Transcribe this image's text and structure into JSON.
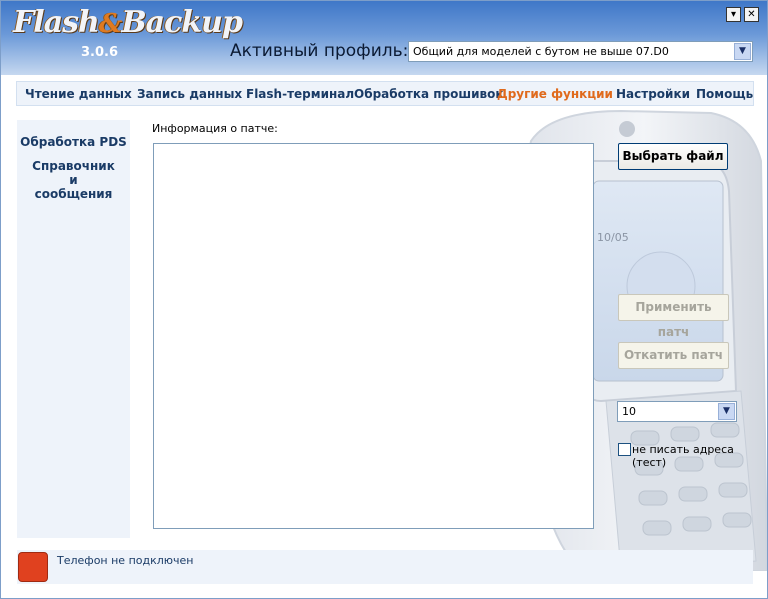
{
  "app": {
    "logo_main": "Flash",
    "logo_amp": "&",
    "logo_end": "Backup",
    "version": "3.0.6"
  },
  "window_controls": {
    "minimize_glyph": "▾",
    "close_glyph": "✕"
  },
  "profile": {
    "label": "Активный профиль:",
    "selected": "Общий для моделей с бутом не выше 07.D0"
  },
  "nav": {
    "items": [
      {
        "label": "Чтение данных",
        "active": false
      },
      {
        "label": "Запись данных",
        "active": false
      },
      {
        "label": "Flash-терминал",
        "active": false
      },
      {
        "label": "Обработка прошивок",
        "active": false
      },
      {
        "label": "Другие функции",
        "active": true
      },
      {
        "label": "Настройки",
        "active": false
      },
      {
        "label": "Помощь",
        "active": false
      }
    ]
  },
  "sidebar": {
    "items": [
      {
        "label": "Обработка PDS"
      },
      {
        "label": "Справочник и сообщения"
      }
    ]
  },
  "patch": {
    "info_label": "Информация о патче:",
    "info_text": "",
    "select_file_label": "Выбрать файл",
    "apply_label": "Применить патч",
    "revert_label": "Откатить патч",
    "count_selected": "10",
    "no_addresses_label": "не писать адреса (тест)",
    "no_addresses_checked": false
  },
  "status": {
    "text": "Телефон не подключен",
    "led_color": "#e0411f"
  },
  "phone_screen": {
    "date_text": "10/05"
  },
  "colors": {
    "accent": "#e06a1c",
    "nav_text": "#1a3b66",
    "header_top": "#3f77c8"
  },
  "icons": {
    "dropdown": "chevron-down-icon",
    "status": "status-led-icon"
  }
}
